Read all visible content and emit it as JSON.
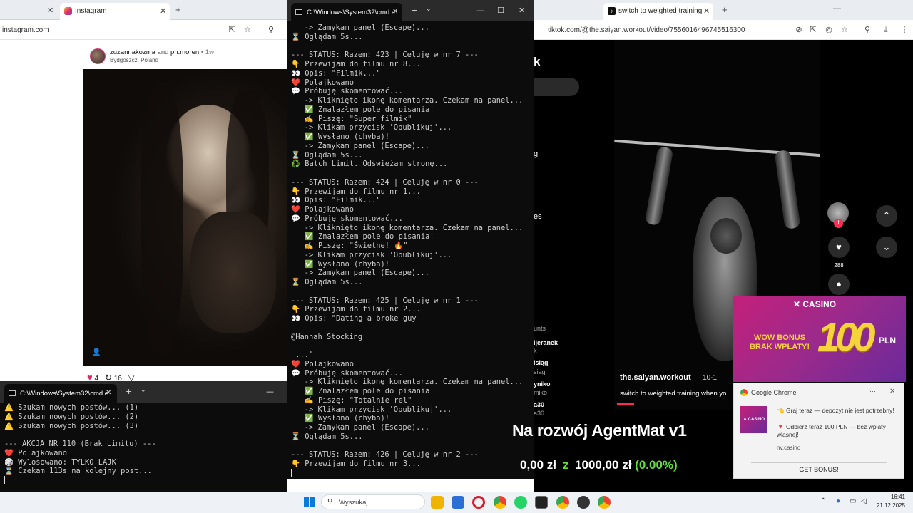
{
  "instagram": {
    "tab_title": "Instagram",
    "url": "instagram.com",
    "post_user": "zuzannakozma",
    "post_and": "and",
    "post_user2": "ph.moren",
    "post_time": "• 1w",
    "post_location": "Bydgoszcz, Poland",
    "likes": "4",
    "shares": "16"
  },
  "cmd_main": {
    "tab_title": "C:\\Windows\\System32\\cmd.e",
    "lines": [
      "   -> Zamykam panel (Escape)...",
      "⏳ Oglądam 5s...",
      "",
      "--- STATUS: Razem: 423 | Celuję w nr 7 ---",
      "👇 Przewijam do filmu nr 8...",
      "👀 Opis: \"Filmik...\"",
      "❤️ Polajkowano",
      "💬 Próbuję skomentować...",
      "   -> Kliknięto ikonę komentarza. Czekam na panel...",
      "   ✅ Znalazłem pole do pisania!",
      "   ✍️ Piszę: \"Super filmik\"",
      "   -> Klikam przycisk 'Opublikuj'...",
      "   ✅ Wysłano (chyba)!",
      "   -> Zamykam panel (Escape)...",
      "⏳ Oglądam 5s...",
      "♻️ Batch Limit. Odświeżam stronę...",
      "",
      "--- STATUS: Razem: 424 | Celuję w nr 0 ---",
      "👇 Przewijam do filmu nr 1...",
      "👀 Opis: \"Filmik...\"",
      "❤️ Polajkowano",
      "💬 Próbuję skomentować...",
      "   -> Kliknięto ikonę komentarza. Czekam na panel...",
      "   ✅ Znalazłem pole do pisania!",
      "   ✍️ Piszę: \"Świetne! 🔥\"",
      "   -> Klikam przycisk 'Opublikuj'...",
      "   ✅ Wysłano (chyba)!",
      "   -> Zamykam panel (Escape)...",
      "⏳ Oglądam 5s...",
      "",
      "--- STATUS: Razem: 425 | Celuję w nr 1 ---",
      "👇 Przewijam do filmu nr 2...",
      "👀 Opis: \"Dating a broke guy",
      "",
      "@Hannah Stocking",
      "",
      " ...\"",
      "❤️ Polajkowano",
      "💬 Próbuję skomentować...",
      "   -> Kliknięto ikonę komentarza. Czekam na panel...",
      "   ✅ Znalazłem pole do pisania!",
      "   ✍️ Piszę: \"Totalnie rel\"",
      "   -> Klikam przycisk 'Opublikuj'...",
      "   ✅ Wysłano (chyba)!",
      "   -> Zamykam panel (Escape)...",
      "⏳ Oglądam 5s...",
      "",
      "--- STATUS: Razem: 426 | Celuję w nr 2 ---",
      "👇 Przewijam do filmu nr 3..."
    ]
  },
  "cmd_small": {
    "tab_title": "C:\\Windows\\System32\\cmd.e",
    "lines": [
      "⚠️ Szukam nowych postów... (1)",
      "⚠️ Szukam nowych postów... (2)",
      "⚠️ Szukam nowych postów... (3)",
      "",
      "--- AKCJA NR 110 (Brak Limitu) ---",
      "❤️ Polajkowano",
      "🎲 Wylosowano: TYLKO LAJK",
      "⏳ Czekam 113s na kolejny post..."
    ]
  },
  "tiktok": {
    "tab_title": "switch to weighted training",
    "url": "tiktok.com/@the.saiyan.workout/video/7556016496745516300",
    "header_fragment": "k",
    "sidebar_fragments": [
      "g",
      "es",
      "unts",
      "ljeranek",
      "k",
      "isiąg",
      "siąg",
      "yniko",
      "miko",
      "a30",
      "a30"
    ],
    "username": "the.saiyan.workout",
    "date": "· 10-1",
    "caption": "switch to weighted training when yo",
    "like_count": "288"
  },
  "casino_ad": {
    "brand": "CASINO",
    "headline_line1": "WOW BONUS",
    "headline_line2": "BRAK WPŁATY!",
    "amount": "100",
    "currency": "PLN"
  },
  "chrome_notification": {
    "app": "Google Chrome",
    "line1": "👈 Graj teraz — depozyt nie jest potrzebny!",
    "line2": "🔻 Odbierz teraz 100 PLN — bez wpłaty własnej!",
    "source": "nv.casino",
    "button": "GET BONUS!"
  },
  "overlay": {
    "title": "Na rozwój AgentMat v1",
    "current": "0,00 zł",
    "sep": "z",
    "goal": "1000,00 zł",
    "percent": "(0.00%)"
  },
  "taskbar": {
    "search_placeholder": "Wyszukaj",
    "time": "16:41",
    "date": "21.12.2025"
  },
  "colors": {
    "cmd_bg": "#0c0c0c",
    "accent_green": "#5ee03b",
    "tiktok_red": "#fe2c55",
    "casino_gold": "#f5d33a"
  }
}
